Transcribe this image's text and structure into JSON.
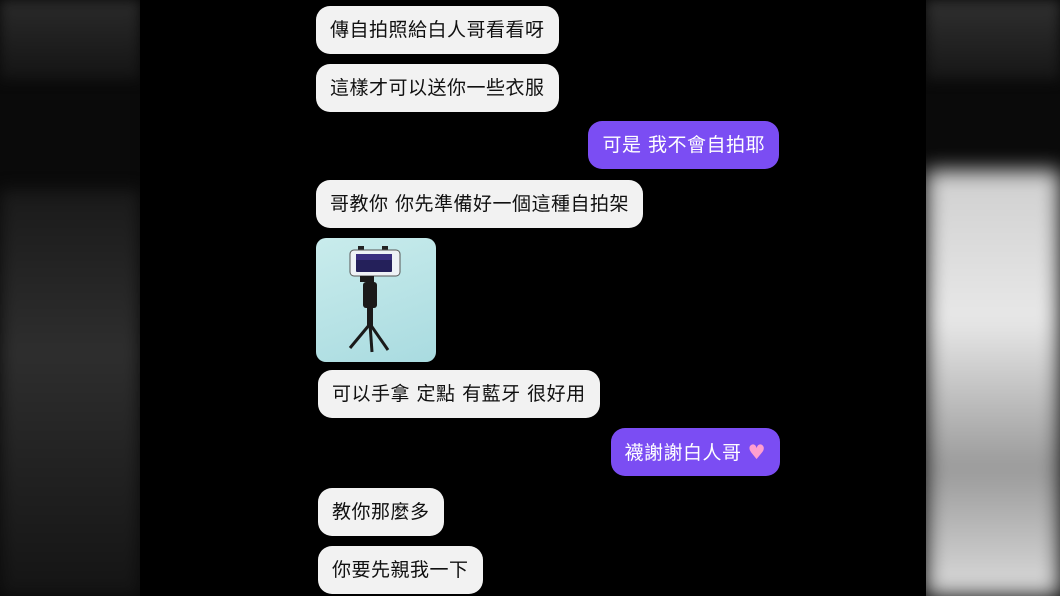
{
  "messages": [
    {
      "from": "other",
      "text": "傳自拍照給白人哥看看呀"
    },
    {
      "from": "other",
      "text": "這樣才可以送你一些衣服"
    },
    {
      "from": "me",
      "text": "可是 我不會自拍耶"
    },
    {
      "from": "other",
      "text": "哥教你 你先準備好一個這種自拍架"
    },
    {
      "from": "other",
      "type": "image",
      "image": "selfie-stick-tripod-photo"
    },
    {
      "from": "other",
      "text": "可以手拿 定點 有藍牙 很好用"
    },
    {
      "from": "me",
      "text": "襪謝謝白人哥",
      "emoji": "♥"
    },
    {
      "from": "other",
      "text": "教你那麼多"
    },
    {
      "from": "other",
      "text": "你要先親我一下"
    }
  ],
  "colors": {
    "incoming_bubble": "#f2f2f2",
    "outgoing_bubble": "#7b4df3",
    "background": "#000000",
    "heart": "#ff9fd0"
  }
}
